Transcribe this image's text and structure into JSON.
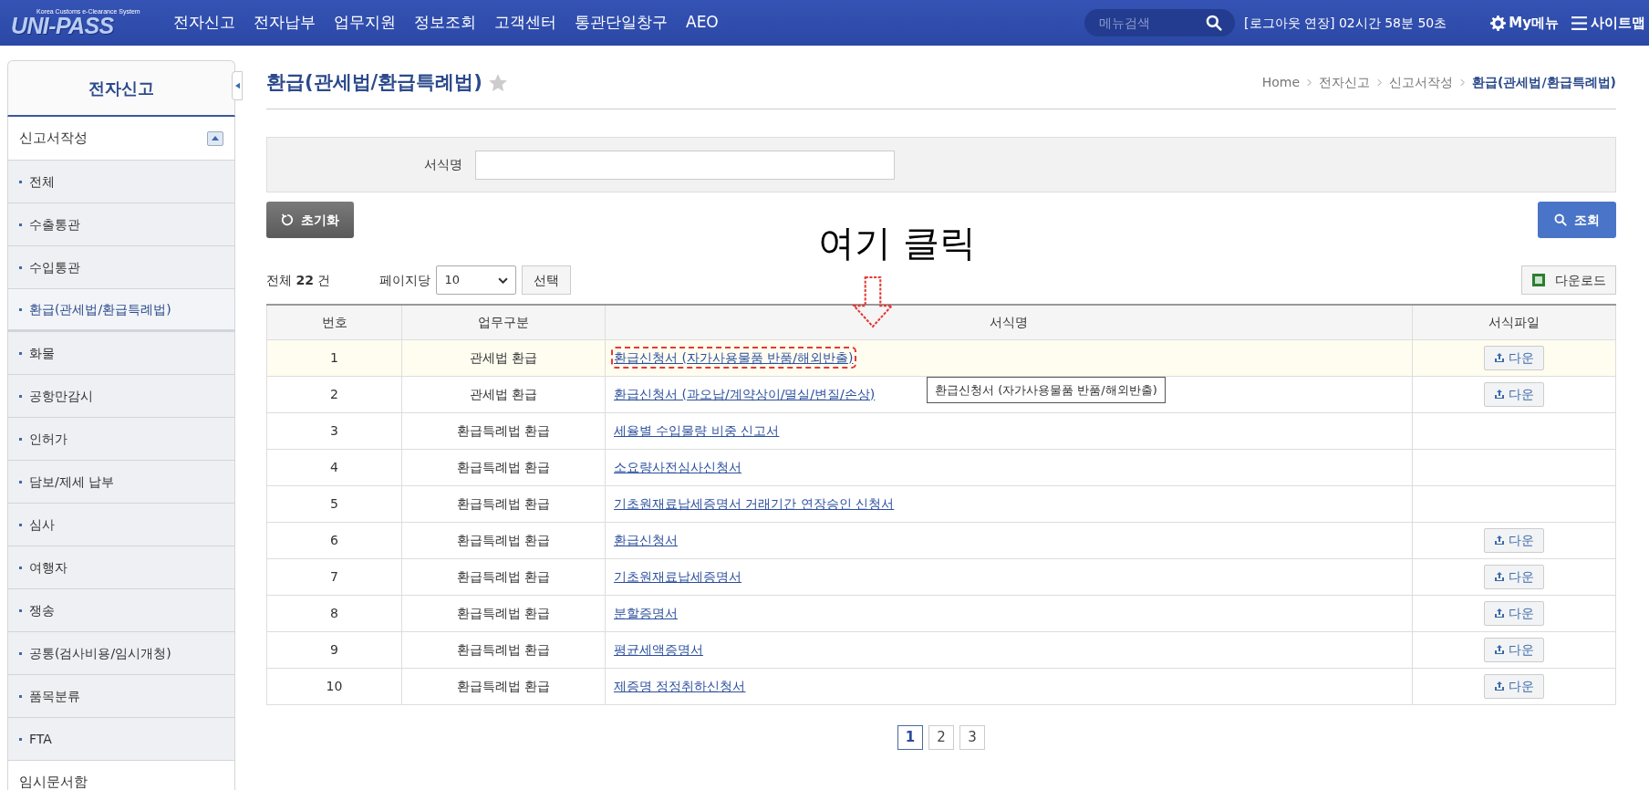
{
  "header": {
    "logo_caption": "Korea Customs e-Clearance System",
    "logo": "UNI-PASS",
    "nav": [
      "전자신고",
      "전자납부",
      "업무지원",
      "정보조회",
      "고객센터",
      "통관단일창구",
      "AEO"
    ],
    "search": {
      "placeholder": "메뉴검색"
    },
    "session": "[로그아웃 연장] 02시간 58분 50초",
    "my_menu": "My메뉴",
    "sitemap": "사이트맵"
  },
  "sidebar": {
    "title": "전자신고",
    "section": {
      "label": "신고서작성",
      "expanded": true
    },
    "items": [
      {
        "label": "전체",
        "selected": false
      },
      {
        "label": "수출통관",
        "selected": false
      },
      {
        "label": "수입통관",
        "selected": false
      },
      {
        "label": "환급(관세법/환급특례법)",
        "selected": true
      },
      {
        "label": "화물",
        "selected": false
      },
      {
        "label": "공항만감시",
        "selected": false
      },
      {
        "label": "인허가",
        "selected": false
      },
      {
        "label": "담보/제세 납부",
        "selected": false
      },
      {
        "label": "심사",
        "selected": false
      },
      {
        "label": "여행자",
        "selected": false
      },
      {
        "label": "쟁송",
        "selected": false
      },
      {
        "label": "공통(검사비용/임시개청)",
        "selected": false
      },
      {
        "label": "품목분류",
        "selected": false
      },
      {
        "label": "FTA",
        "selected": false
      }
    ],
    "footer_item": "임시문서함"
  },
  "page": {
    "title": "환급(관세법/환급특례법)",
    "favorite": false,
    "breadcrumb": [
      "Home",
      "전자신고",
      "신고서작성",
      "환급(관세법/환급특례법)"
    ]
  },
  "filter": {
    "label": "서식명"
  },
  "reset_button": "초기화",
  "search_button": "조회",
  "annotation": "여기 클릭",
  "summary": {
    "prefix": "전체",
    "count": "22",
    "suffix": "건",
    "per_page_label": "페이지당",
    "per_page": "10",
    "select_button": "선택",
    "download_button": "다운로드"
  },
  "table": {
    "columns": [
      "번호",
      "업무구분",
      "서식명",
      "서식파일"
    ],
    "rows": [
      {
        "no": "1",
        "category": "관세법 환급",
        "form": "환급신청서 (자가사용물품 반품/해외반출)",
        "file": "다운",
        "highlighted": true,
        "marked": true
      },
      {
        "no": "2",
        "category": "관세법 환급",
        "form": "환급신청서 (과오납/계약상이/멸실/변질/손상)",
        "file": "다운",
        "highlighted": false,
        "marked": false
      },
      {
        "no": "3",
        "category": "환급특례법 환급",
        "form": "세율별 수입물량 비중 신고서",
        "highlighted": false,
        "marked": false
      },
      {
        "no": "4",
        "category": "환급특례법 환급",
        "form": "소요량사전심사신청서",
        "highlighted": false,
        "marked": false
      },
      {
        "no": "5",
        "category": "환급특례법 환급",
        "form": "기초원재료납세증명서 거래기간 연장승인 신청서",
        "highlighted": false,
        "marked": false
      },
      {
        "no": "6",
        "category": "환급특례법 환급",
        "form": "환급신청서",
        "file": "다운",
        "highlighted": false,
        "marked": false
      },
      {
        "no": "7",
        "category": "환급특례법 환급",
        "form": "기초원재료납세증명서",
        "file": "다운",
        "highlighted": false,
        "marked": false
      },
      {
        "no": "8",
        "category": "환급특례법 환급",
        "form": "분할증명서",
        "file": "다운",
        "highlighted": false,
        "marked": false
      },
      {
        "no": "9",
        "category": "환급특례법 환급",
        "form": "평균세액증명서",
        "file": "다운",
        "highlighted": false,
        "marked": false
      },
      {
        "no": "10",
        "category": "환급특례법 환급",
        "form": "제증명 정정취하신청서",
        "file": "다운",
        "highlighted": false,
        "marked": false
      }
    ],
    "tooltip": "환급신청서 (자가사용물품 반품/해외반출)"
  },
  "pagination": [
    {
      "label": "1",
      "selected": true
    },
    {
      "label": "2",
      "selected": false
    },
    {
      "label": "3",
      "selected": false
    }
  ]
}
